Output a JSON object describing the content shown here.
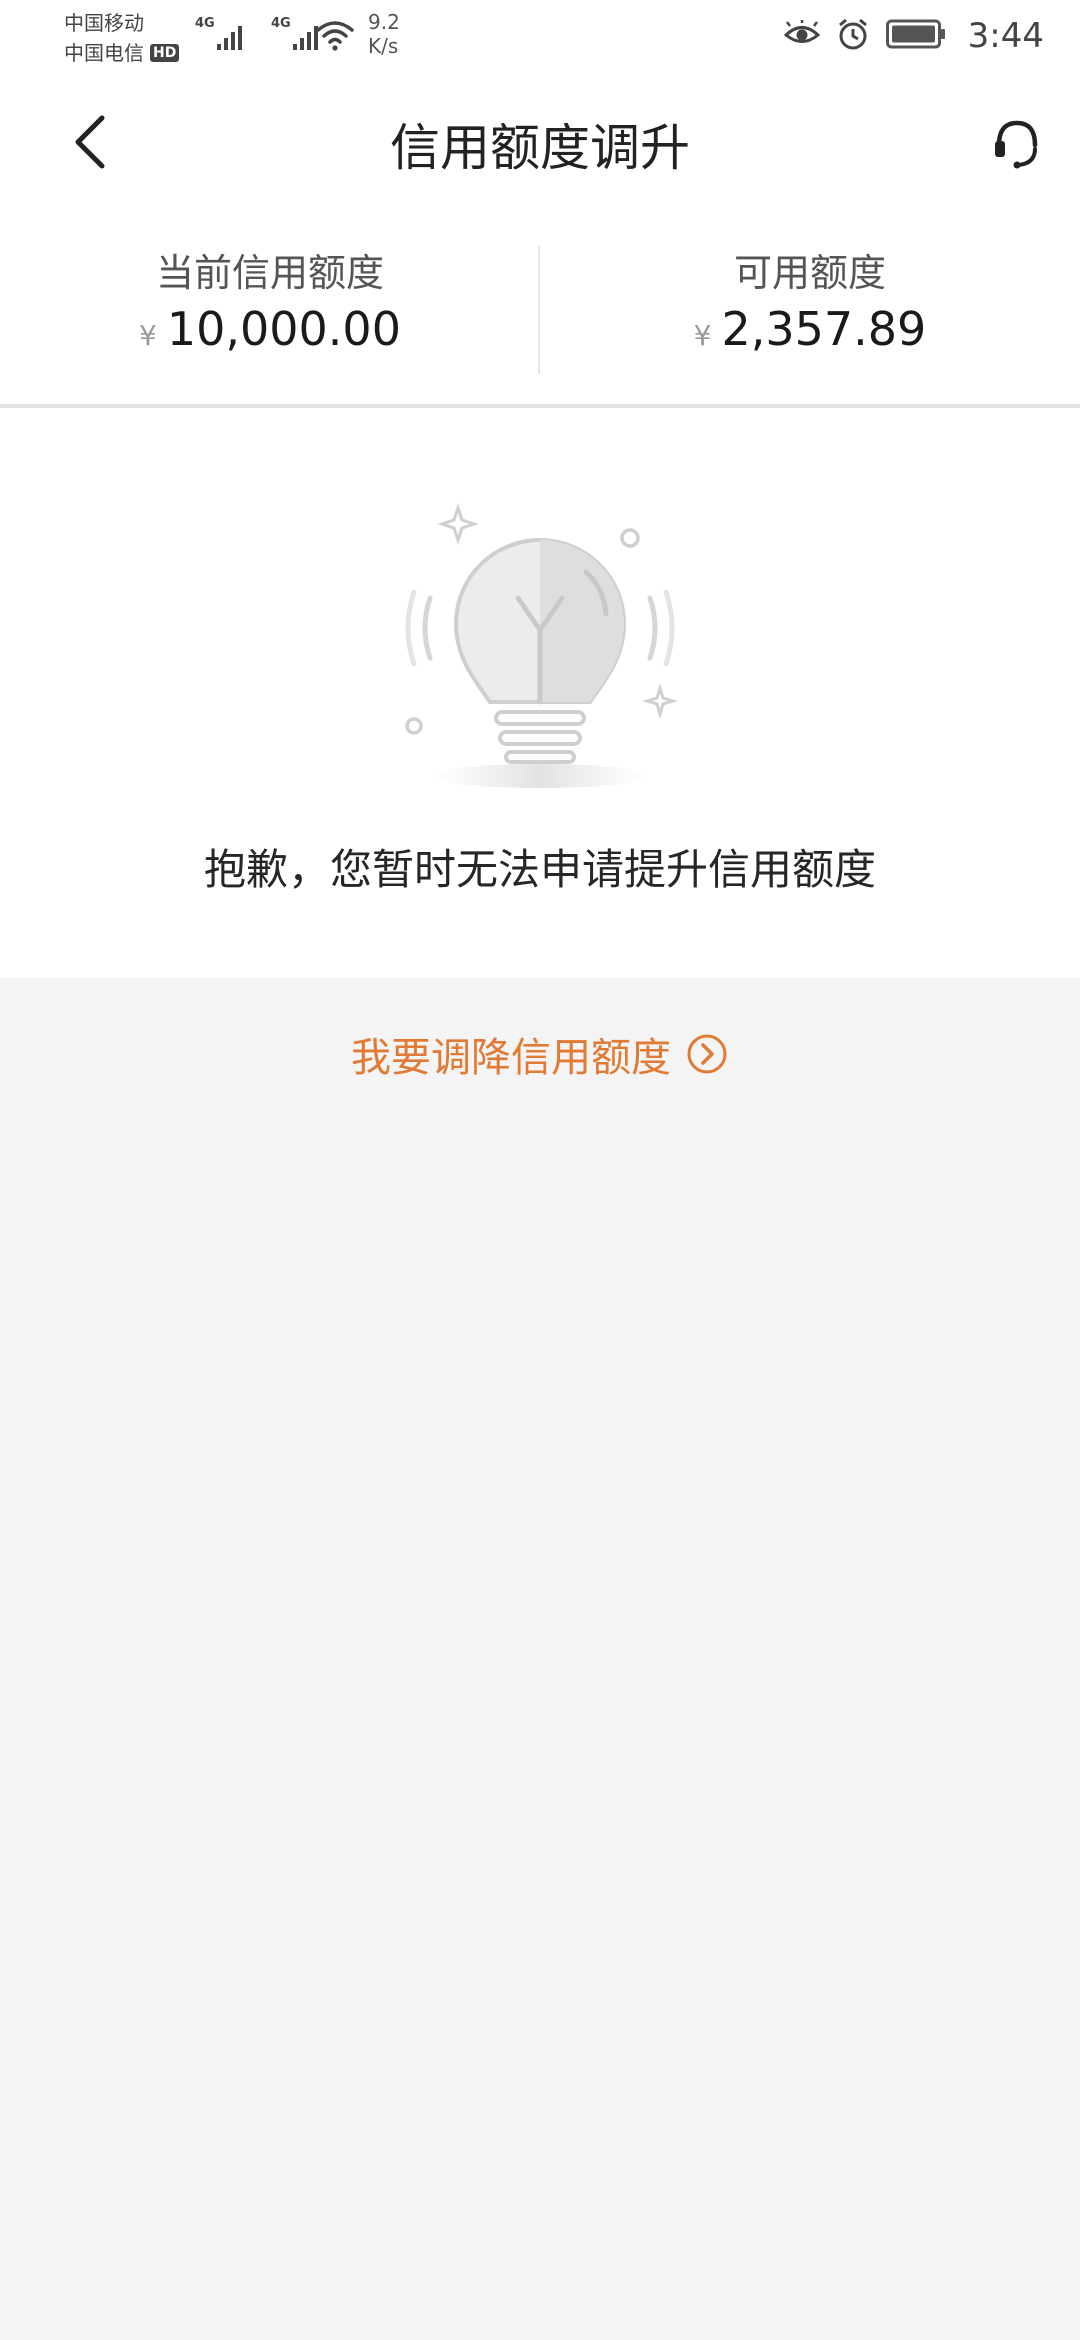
{
  "status_bar": {
    "carrier_1": "中国移动",
    "carrier_2": "中国电信",
    "hd_badge": "HD",
    "signal_1_label": "4G",
    "signal_2_label": "4G",
    "net_speed_value": "9.2",
    "net_speed_unit": "K/s",
    "time": "3:44",
    "icons": [
      "eye-icon",
      "alarm-icon",
      "battery-icon",
      "signal-icon",
      "wifi-icon"
    ]
  },
  "header": {
    "title": "信用额度调升",
    "back_icon": "chevron-left-icon",
    "service_icon": "headset-icon"
  },
  "credit": {
    "current_label": "当前信用额度",
    "current_currency": "¥",
    "current_amount": "10,000.00",
    "available_label": "可用额度",
    "available_currency": "¥",
    "available_amount": "2,357.89"
  },
  "empty_state": {
    "icon": "lightbulb-icon",
    "message": "抱歉，您暂时无法申请提升信用额度"
  },
  "actions": {
    "decrease_label": "我要调降信用额度",
    "decrease_icon": "circle-chevron-right-icon"
  },
  "colors": {
    "accent": "#e07a35",
    "background": "#f4f4f4",
    "panel": "#ffffff",
    "title_text": "#222222",
    "secondary_text": "#555555"
  }
}
